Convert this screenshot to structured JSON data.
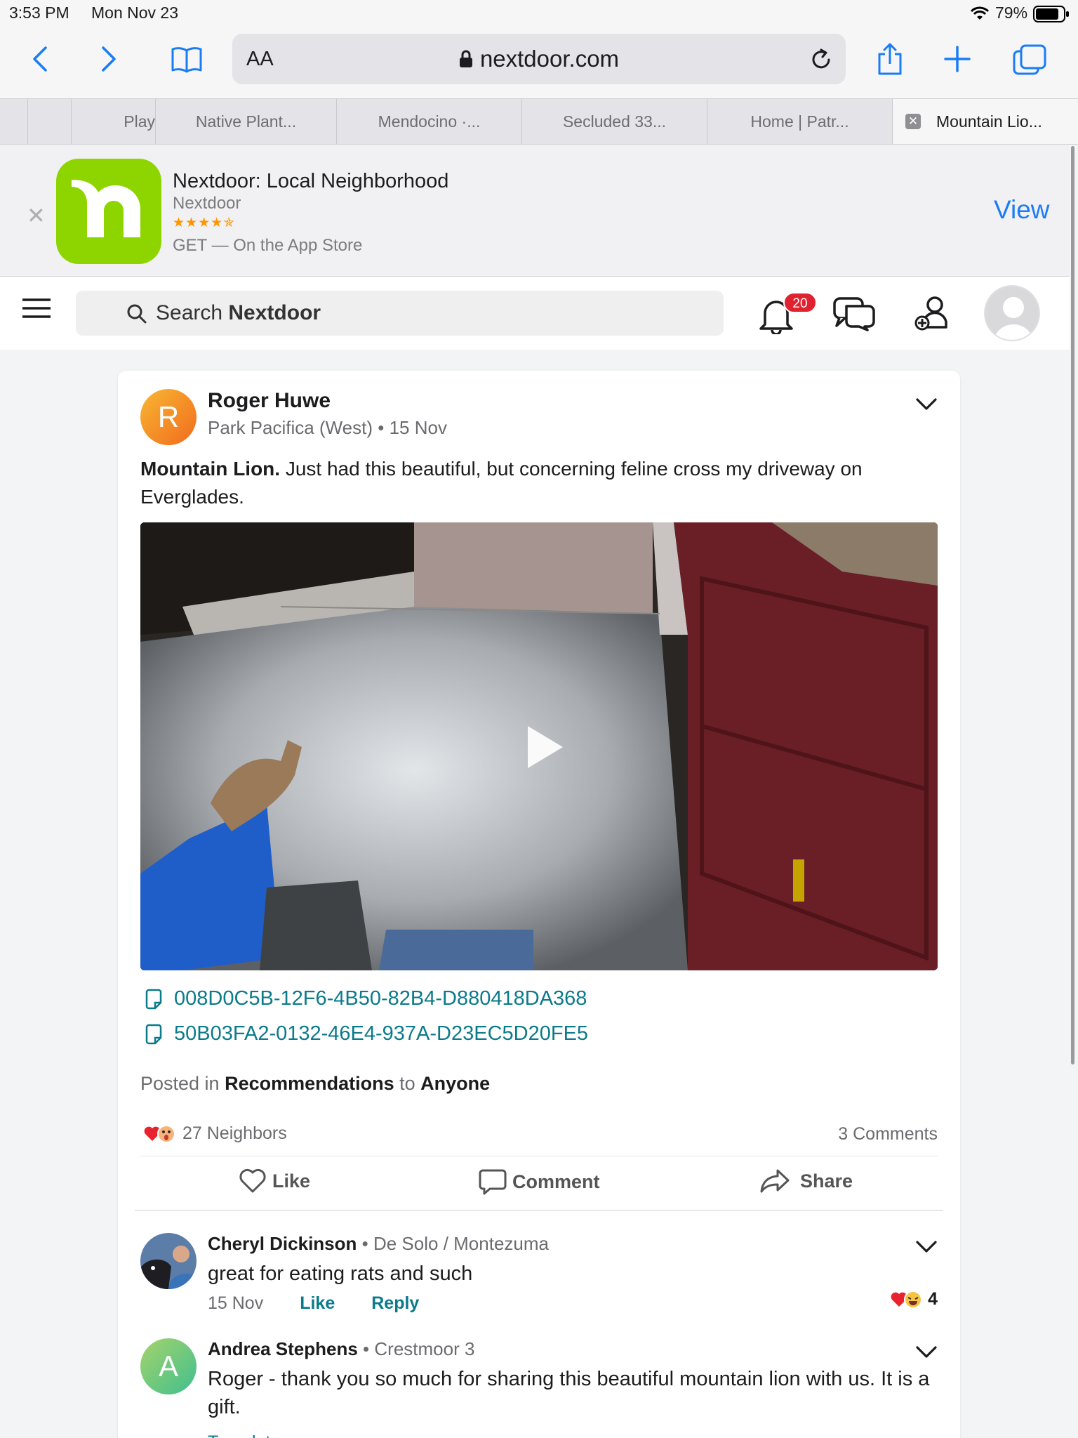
{
  "status_bar": {
    "time": "3:53 PM",
    "date": "Mon Nov 23",
    "battery": "79%"
  },
  "browser": {
    "url": "nextdoor.com",
    "text_size_label": "AA",
    "tabs": [
      "Play",
      "Native Plant...",
      "Mendocino ·...",
      "Secluded 33...",
      "Home | Patr...",
      "Mountain Lio..."
    ]
  },
  "app_banner": {
    "title": "Nextdoor: Local Neighborhood",
    "developer": "Nextdoor",
    "stars": "★★★★✯",
    "get_label": "GET — On the App Store",
    "view_label": "View"
  },
  "header": {
    "search_prefix": "Search ",
    "search_brand": "Nextdoor",
    "notification_count": "20"
  },
  "post": {
    "author_initial": "R",
    "author": "Roger Huwe",
    "neighborhood": "Park Pacifica (West)",
    "date": "15 Nov",
    "title": "Mountain Lion.",
    "body": " Just had this beautiful, but concerning feline cross my driveway on Everglades.",
    "attachments": [
      "008D0C5B-12F6-4B50-82B4-D880418DA368",
      "50B03FA2-0132-46E4-937A-D23EC5D20FE5"
    ],
    "posted_in_label": "Posted in ",
    "category": "Recommendations",
    "to_label": " to ",
    "audience": "Anyone",
    "reaction_count": "27 Neighbors",
    "comment_count": "3 Comments",
    "actions": {
      "like": "Like",
      "comment": "Comment",
      "share": "Share"
    }
  },
  "comments": [
    {
      "name": "Cheryl Dickinson",
      "neighborhood": "De Solo / Montezuma",
      "text": "great for eating rats and such",
      "date": "15 Nov",
      "like": "Like",
      "reply": "Reply",
      "reactions": "4"
    },
    {
      "initial": "A",
      "name": "Andrea Stephens",
      "neighborhood": "Crestmoor 3",
      "text": "Roger - thank you so much for sharing this beautiful mountain lion with us.  It is a gift.",
      "translate": "Translate"
    }
  ],
  "colors": {
    "accent_blue": "#1a7cf5",
    "link_teal": "#0b7a8a",
    "badge_red": "#e0212f",
    "nextdoor_green": "#8ed500"
  }
}
